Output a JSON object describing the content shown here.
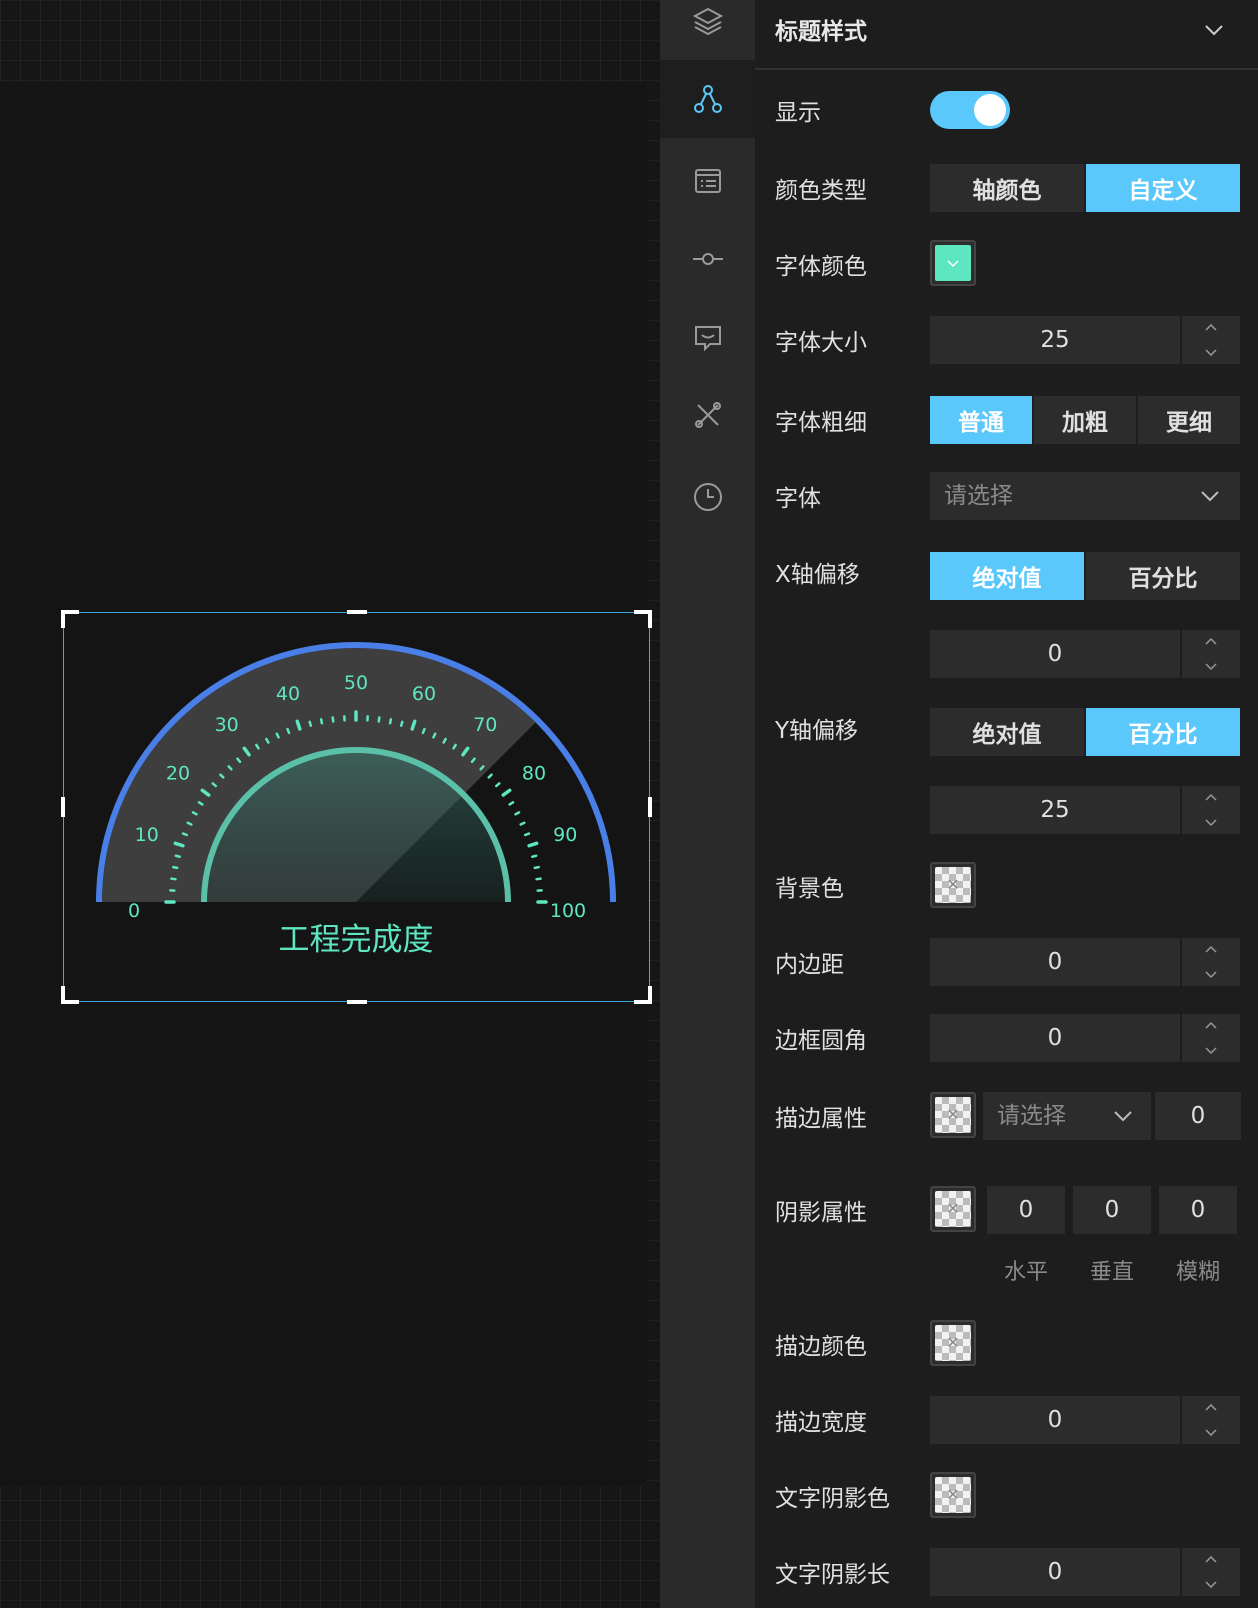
{
  "gauge": {
    "title": "工程完成度",
    "ticks": [
      "0",
      "10",
      "20",
      "30",
      "40",
      "50",
      "60",
      "70",
      "80",
      "90",
      "100"
    ],
    "value_percent": 75,
    "colors": {
      "arc": "#4a7fe8",
      "inner": "#5bc0a8",
      "text": "#5ee6c0"
    }
  },
  "toolbar": {
    "icons": [
      "layers-icon",
      "nodes-icon",
      "list-icon",
      "connector-icon",
      "chat-icon",
      "tools-icon",
      "clock-icon"
    ]
  },
  "panel": {
    "title": "标题样式",
    "show": {
      "label": "显示",
      "on": true
    },
    "color_type": {
      "label": "颜色类型",
      "options": [
        "轴颜色",
        "自定义"
      ],
      "selected": 1
    },
    "font_color": {
      "label": "字体颜色",
      "color": "#5ee6c0"
    },
    "font_size": {
      "label": "字体大小",
      "value": "25"
    },
    "font_weight": {
      "label": "字体粗细",
      "options": [
        "普通",
        "加粗",
        "更细"
      ],
      "selected": 0
    },
    "font_family": {
      "label": "字体",
      "placeholder": "请选择"
    },
    "x_offset": {
      "label": "X轴偏移",
      "options": [
        "绝对值",
        "百分比"
      ],
      "selected": 0,
      "value": "0"
    },
    "y_offset": {
      "label": "Y轴偏移",
      "options": [
        "绝对值",
        "百分比"
      ],
      "selected": 1,
      "value": "25"
    },
    "background": {
      "label": "背景色"
    },
    "padding": {
      "label": "内边距",
      "value": "0"
    },
    "border_radius": {
      "label": "边框圆角",
      "value": "0"
    },
    "stroke_attr": {
      "label": "描边属性",
      "placeholder": "请选择",
      "value": "0"
    },
    "shadow_attr": {
      "label": "阴影属性",
      "values": [
        "0",
        "0",
        "0"
      ],
      "captions": [
        "水平",
        "垂直",
        "模糊"
      ]
    },
    "stroke_color": {
      "label": "描边颜色"
    },
    "stroke_width": {
      "label": "描边宽度",
      "value": "0"
    },
    "text_shadow_color": {
      "label": "文字阴影色"
    },
    "text_shadow_len": {
      "label": "文字阴影长",
      "value": "0"
    }
  }
}
